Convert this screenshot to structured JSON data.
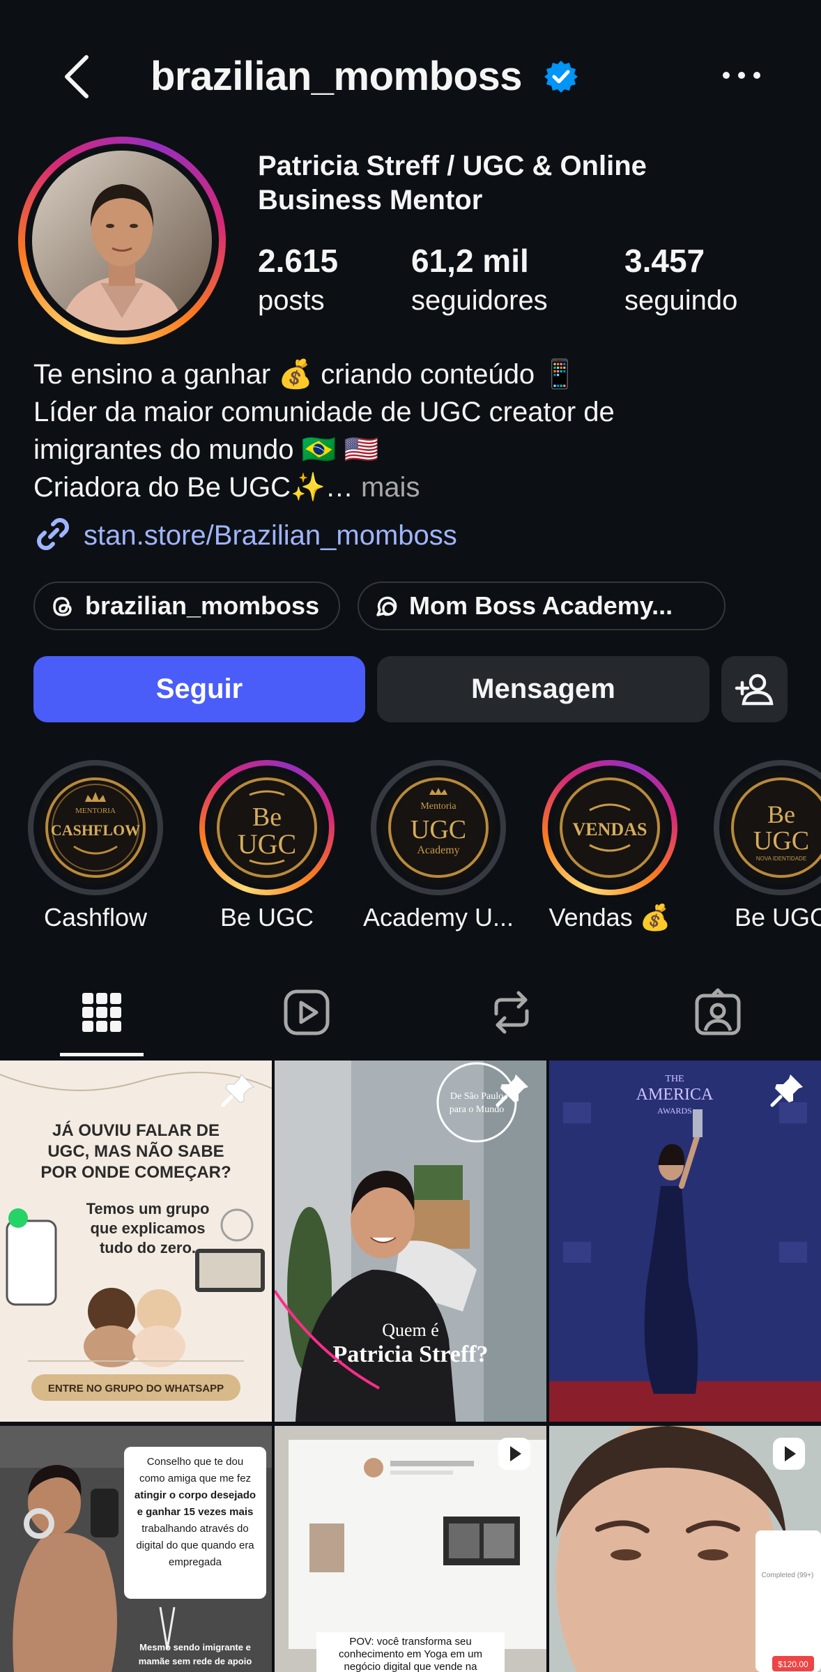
{
  "header": {
    "username": "brazilian_momboss",
    "icons": [
      "back-arrow-icon",
      "verified-badge-icon",
      "more-options-icon"
    ]
  },
  "profile": {
    "full_name": "Patricia Streff / UGC & Online Business Mentor",
    "stats": [
      {
        "value": "2.615",
        "label": "posts"
      },
      {
        "value": "61,2 mil",
        "label": "seguidores"
      },
      {
        "value": "3.457",
        "label": "seguindo"
      }
    ],
    "bio": [
      "Te ensino a ganhar 💰 criando conteúdo 📱",
      "Líder da maior comunidade de UGC creator de",
      "imigrantes do mundo 🇧🇷 🇺🇸",
      "Criadora do Be UGC✨…"
    ],
    "bio_more": "mais",
    "link": "stan.store/Brazilian_momboss"
  },
  "chips": [
    {
      "label": "brazilian_momboss",
      "icon": "threads-icon"
    },
    {
      "label": "Mom Boss Academy...",
      "icon": "channel-icon"
    }
  ],
  "actions": {
    "follow": "Seguir",
    "message": "Mensagem",
    "add_icon": "add-person-icon"
  },
  "highlights": [
    {
      "label": "Cashflow",
      "badge_top": "MENTORIA",
      "badge_main": "CASHFLOW",
      "seen": true
    },
    {
      "label": "Be UGC",
      "badge_top": "Be",
      "badge_main": "UGC",
      "seen": false
    },
    {
      "label": "Academy U...",
      "badge_top": "Mentoria",
      "badge_main": "UGC",
      "badge_bottom": "Academy",
      "seen": true
    },
    {
      "label": "Vendas 💰",
      "badge_main": "VENDAS",
      "seen": false
    },
    {
      "label": "Be UGC",
      "badge_top": "Be",
      "badge_main": "UGC",
      "badge_bottom": "NOVA IDENTIDADE",
      "seen": true
    }
  ],
  "tabs": [
    "grid-icon",
    "reels-icon",
    "reposts-icon",
    "tagged-icon"
  ],
  "posts": [
    {
      "pinned": true,
      "headline": [
        "JÁ OUVIU FALAR DE",
        "UGC, MAS NÃO SABE",
        "POR ONDE COMEÇAR?"
      ],
      "sub": [
        "Temos um grupo",
        "que explicamos",
        "tudo do zero."
      ],
      "cta": "ENTRE NO GRUPO DO WHATSAPP"
    },
    {
      "pinned": true,
      "stamp": [
        "De São Paulo",
        "para o Mundo"
      ],
      "caption_top": "Quem é",
      "caption_main": "Patricia Streff?"
    },
    {
      "pinned": true,
      "banner": [
        "THE",
        "AMERICA",
        "AWARDS"
      ]
    },
    {
      "reel": false,
      "caption": [
        "Conselho que te dou",
        "como amiga que me fez",
        "atingir o corpo desejado",
        "e ganhar 15 vezes mais",
        "trabalhando através do",
        "digital do que quando era",
        "empregada"
      ],
      "footer": [
        "Mesmo sendo imigrante e",
        "mamãe sem rede de apoio"
      ]
    },
    {
      "reel": true,
      "caption": [
        "POV: você transforma seu",
        "conhecimento em Yoga em um",
        "negócio digital que vende na"
      ]
    },
    {
      "reel": true,
      "overlay": [
        "Completed (99+)",
        "$120.00"
      ]
    }
  ]
}
